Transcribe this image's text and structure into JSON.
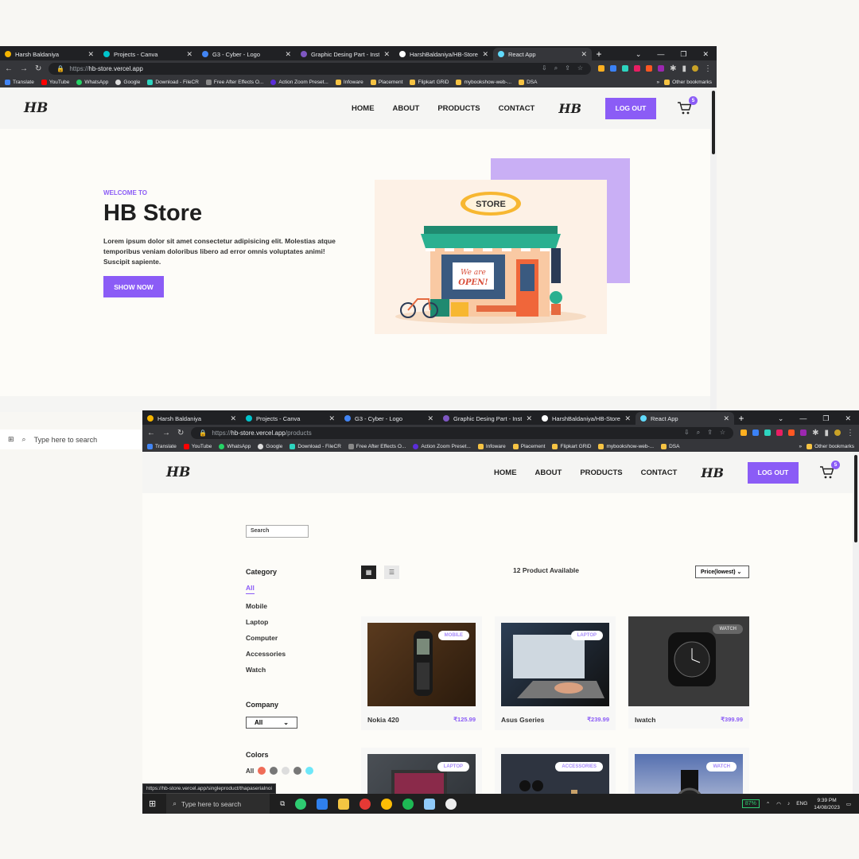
{
  "browser": {
    "tabs": [
      {
        "label": "Harsh Baldaniya",
        "color": "#f4b400"
      },
      {
        "label": "Projects - Canva",
        "color": "#00c4cc"
      },
      {
        "label": "G3 - Cyber - Logo",
        "color": "#4285f4"
      },
      {
        "label": "Graphic Desing Part - Insta",
        "color": "#7e57c2"
      },
      {
        "label": "HarshBaldaniya/HB-Store",
        "color": "#ffffff"
      },
      {
        "label": "React App",
        "color": "#61dafb"
      }
    ],
    "new_tab": "+",
    "url1_prefix": "https://",
    "url1_host": "hb-store.vercel.app",
    "url2_prefix": "https://",
    "url2_host": "hb-store.vercel.app",
    "url2_path": "/products",
    "bookmarks": [
      "Translate",
      "YouTube",
      "WhatsApp",
      "Google",
      "Download - FileCR",
      "Free After Effects O...",
      "Action Zoom Preset...",
      "Infoware",
      "Placement",
      "Flipkart GRiD",
      "mybookshow-web-...",
      "DSA"
    ],
    "other_bookmarks": "Other bookmarks",
    "more": "»"
  },
  "site": {
    "logo": "HB",
    "nav": [
      "HOME",
      "ABOUT",
      "PRODUCTS",
      "CONTACT"
    ],
    "logout": "LOG OUT",
    "cart_count": "5"
  },
  "hero": {
    "welcome": "WELCOME TO",
    "title": "HB Store",
    "desc": "Lorem ipsum dolor sit amet consectetur adipisicing elit. Molestias atque temporibus veniam doloribus libero ad error omnis voluptates animi! Suscipit sapiente.",
    "button": "SHOW NOW",
    "store_sign": "STORE",
    "open_sign": "We are OPEN!",
    "open_vertical": "OPEN"
  },
  "products_page": {
    "search_placeholder": "Search",
    "category_heading": "Category",
    "categories": [
      "All",
      "Mobile",
      "Laptop",
      "Computer",
      "Accessories",
      "Watch"
    ],
    "company_heading": "Company",
    "company_value": "All",
    "colors_heading": "Colors",
    "colors_all": "All",
    "color_swatches": [
      "#ef6c57",
      "#777777",
      "#dddddd",
      "#777777",
      "#6ee7f9"
    ],
    "count_text": "12 Product Available",
    "sort_value": "Price(lowest)",
    "products": [
      {
        "name": "Nokia 420",
        "price": "₹125.99",
        "tag": "MOBILE"
      },
      {
        "name": "Asus Gseries",
        "price": "₹239.99",
        "tag": "LAPTOP"
      },
      {
        "name": "Iwatch",
        "price": "₹399.99",
        "tag": "WATCH"
      },
      {
        "name": "",
        "price": "",
        "tag": "LAPTOP"
      },
      {
        "name": "",
        "price": "",
        "tag": "ACCESSORIES"
      },
      {
        "name": "",
        "price": "",
        "tag": "WATCH"
      }
    ]
  },
  "status_url": "https://hb-store.vercel.app/singleproduct/thapaserialnoi",
  "taskbar": {
    "search": "Type here to search",
    "battery": "87%",
    "lang": "ENG",
    "time": "9:39 PM",
    "date": "14/08/2023"
  }
}
